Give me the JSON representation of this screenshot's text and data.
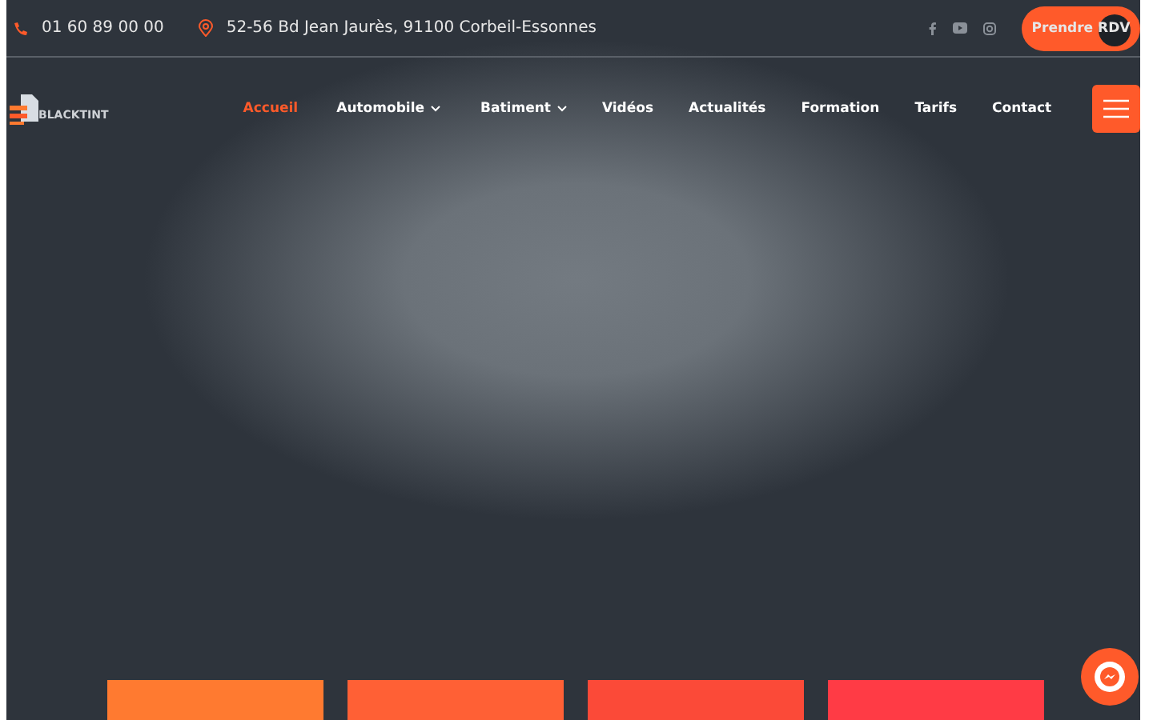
{
  "top_bar": {
    "phone": "01 60 89 00 00",
    "address": "52-56 Bd Jean Jaurès, 91100 Corbeil-Essonnes",
    "cta": "Prendre RDV"
  },
  "logo": {
    "text": "BLACKTINT"
  },
  "nav": [
    {
      "label": "Accueil",
      "selected": true,
      "dropdown": false
    },
    {
      "label": "Automobile",
      "selected": false,
      "dropdown": true
    },
    {
      "label": "Batiment",
      "selected": false,
      "dropdown": true
    },
    {
      "label": "Vidéos",
      "selected": false,
      "dropdown": false
    },
    {
      "label": "Actualités",
      "selected": false,
      "dropdown": false
    },
    {
      "label": "Formation",
      "selected": false,
      "dropdown": false
    },
    {
      "label": "Tarifs",
      "selected": false,
      "dropdown": false
    },
    {
      "label": "Contact",
      "selected": false,
      "dropdown": false
    }
  ],
  "cards": [
    {
      "color": "#ff7a30"
    },
    {
      "color": "#ff6035"
    },
    {
      "color": "#fb4a38"
    },
    {
      "color": "#ff3b45"
    }
  ]
}
